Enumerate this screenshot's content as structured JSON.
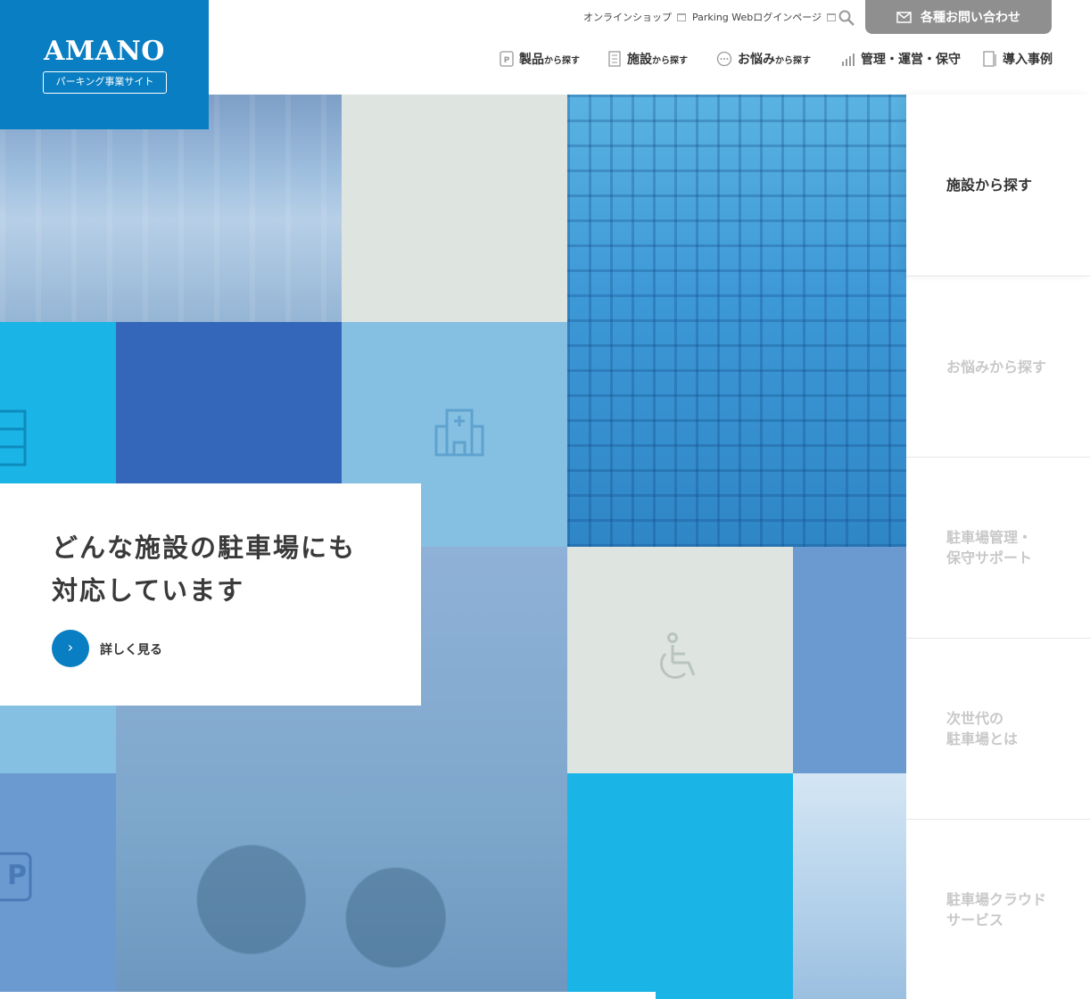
{
  "brand": {
    "name": "AMANO",
    "subtitle": "パーキング事業サイト",
    "color": "#0a7ec2"
  },
  "header": {
    "utility_links": [
      {
        "label": "オンラインショップ"
      },
      {
        "label": "Parking Webログインページ"
      }
    ],
    "search_icon": "search-icon",
    "contact_label": "各種お問い合わせ",
    "nav": [
      {
        "main": "製品",
        "suffix": "から探す",
        "icon": "parking-icon"
      },
      {
        "main": "施設",
        "suffix": "から探す",
        "icon": "building-icon"
      },
      {
        "main": "お悩み",
        "suffix": "から探す",
        "icon": "chat-bubble-icon"
      },
      {
        "main": "管理・運営・保守",
        "suffix": "",
        "icon": "bar-chart-icon"
      },
      {
        "main": "導入事例",
        "suffix": "",
        "icon": "document-icon"
      }
    ]
  },
  "hero": {
    "title_line1": "どんな施設の駐車場にも",
    "title_line2": "対応しています",
    "more_label": "詳しく見る"
  },
  "side_nav": [
    {
      "label": "施設から探す",
      "active": true
    },
    {
      "label": "お悩みから探す",
      "active": false
    },
    {
      "label": "駐車場管理・\n保守サポート",
      "active": false
    },
    {
      "label": "次世代の\n駐車場とは",
      "active": false
    },
    {
      "label": "駐車場クラウド\nサービス",
      "active": false
    }
  ],
  "colors": {
    "tile_cyan": "#1ab4e6",
    "tile_royal": "#3467b9",
    "tile_light": "#85c0e2",
    "tile_cream": "#dee5e0",
    "tile_slate": "#6b9ad0",
    "contact_gray": "#8f8f8f"
  }
}
